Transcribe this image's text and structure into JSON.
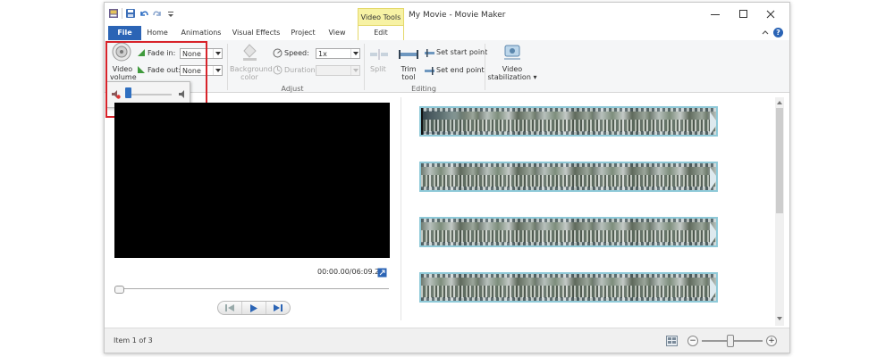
{
  "window": {
    "title": "My Movie - Movie Maker",
    "contextual_tab_header": "Video Tools"
  },
  "tabs": [
    {
      "label": "File"
    },
    {
      "label": "Home"
    },
    {
      "label": "Animations"
    },
    {
      "label": "Visual Effects"
    },
    {
      "label": "Project"
    },
    {
      "label": "View"
    },
    {
      "label": "Edit"
    }
  ],
  "ribbon": {
    "audio": {
      "video_volume_label": "Video volume",
      "fade_in_label": "Fade in:",
      "fade_in_value": "None",
      "fade_out_label": "Fade out:",
      "fade_out_value": "None"
    },
    "adjust": {
      "background_color_label": "Background color",
      "speed_label": "Speed:",
      "speed_value": "1x",
      "duration_label": "Duration:",
      "duration_value": "",
      "group_label": "Adjust"
    },
    "editing": {
      "split_label": "Split",
      "trim_tool_label": "Trim tool",
      "set_start_point_label": "Set start point",
      "set_end_point_label": "Set end point",
      "group_label": "Editing"
    },
    "stabilization": {
      "label": "Video stabilization"
    }
  },
  "volume_popup": {
    "level": 0.0
  },
  "preview": {
    "timecode": "00:00.00/06:09.24",
    "seek_position": 0.0
  },
  "storyboard": {
    "clip_count": 4
  },
  "status": {
    "item_text": "Item 1 of 3",
    "zoom_level": 0.45
  },
  "colors": {
    "file_tab": "#2b64b5",
    "contextual_tab": "#f7f2a4",
    "highlight_box": "#d8232a",
    "clip_border": "#8ec9d8"
  }
}
